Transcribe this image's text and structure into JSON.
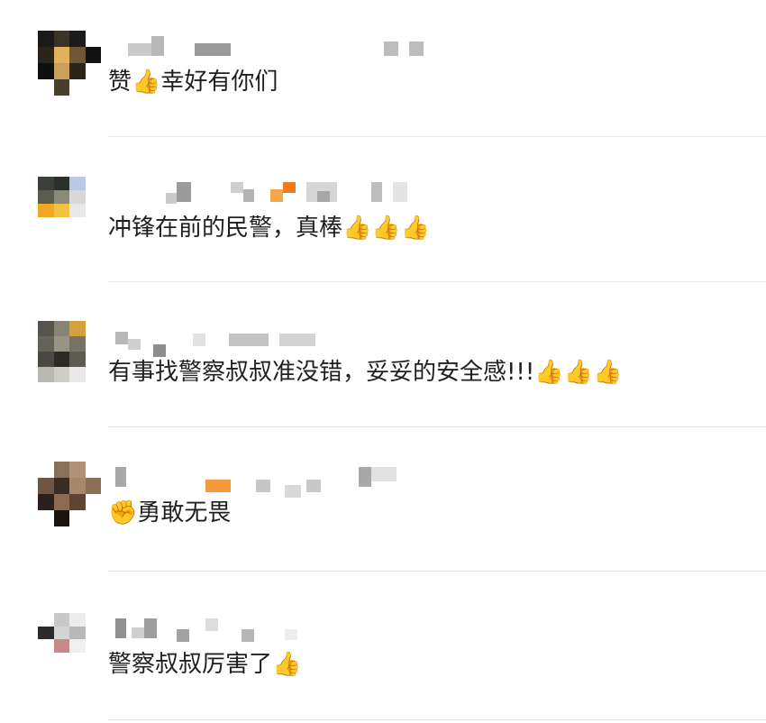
{
  "comments": [
    {
      "author": "",
      "text": "赞👍幸好有你们"
    },
    {
      "author": "",
      "text": "冲锋在前的民警，真棒👍👍👍"
    },
    {
      "author": "",
      "text": "有事找警察叔叔准没错，妥妥的安全感!!!👍👍👍"
    },
    {
      "author": "",
      "text": "✊勇敢无畏"
    },
    {
      "author": "",
      "text": "警察叔叔厉害了👍"
    }
  ],
  "colors": {
    "divider": "#e8e8e8",
    "text": "#1f1f1f",
    "thumb": "#f5b400",
    "thumb_cuff": "#2aa84a"
  },
  "icons": [
    "avatar",
    "thumbs-up-icon",
    "raised-fist-icon"
  ]
}
